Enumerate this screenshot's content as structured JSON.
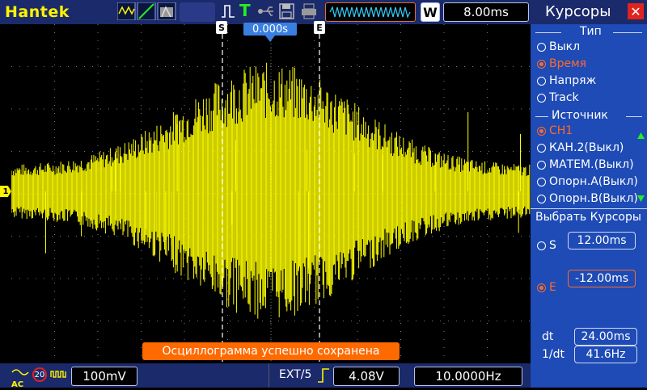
{
  "topbar": {
    "brand": "Hantek",
    "trigger_mode_letter": "T",
    "run_mode_letter": "W",
    "timebase": "8.00ms"
  },
  "screen": {
    "cursor_s_label": "S",
    "cursor_e_label": "E",
    "trigger_position": "0.000s",
    "ch1_marker": "1",
    "toast": "Осциллограмма  успешно  сохранена",
    "trace_color": "#ffff00",
    "grid_color": "#7a7a7a"
  },
  "bottombar": {
    "coupling": "AC",
    "bw_limit": "20",
    "ch1_scale": "100mV",
    "trigger_source": "EXT/5",
    "trigger_level": "4.08V",
    "frequency": "10.0000Hz"
  },
  "panel": {
    "title": "Курсоры",
    "close": "✕",
    "type_group": {
      "title": "Тип",
      "options": [
        "Выкл",
        "Время",
        "Напряж",
        "Track"
      ],
      "selected": 1
    },
    "source_group": {
      "title": "Источник",
      "options": [
        "CH1",
        "КАН.2(Выкл)",
        "МАТЕМ.(Выкл)",
        "Опорн.А(Выкл)",
        "Опорн.В(Выкл)"
      ],
      "selected": 0
    },
    "select_label": "Выбрать  Курсоры",
    "s_label": "S",
    "s_value": "12.00ms",
    "e_label": "E",
    "e_value": "-12.00ms",
    "dt_label": "dt",
    "dt_value": "24.00ms",
    "inv_dt_label": "1/dt",
    "inv_dt_value": "41.6Hz"
  },
  "colors": {
    "bar_bg": "#1b2a6b",
    "panel_bg": "#1e4bb5",
    "accent_orange": "#ff6a00",
    "brand_yellow": "#fff200"
  }
}
